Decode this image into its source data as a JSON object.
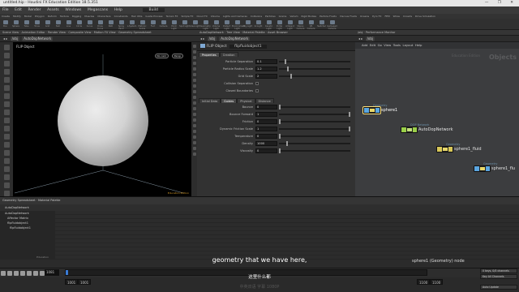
{
  "window": {
    "title": "untitled.hip - Houdini FX Education Edition 18.5.351"
  },
  "menu": [
    "File",
    "Edit",
    "Render",
    "Assets",
    "Windows",
    "Megascans",
    "Help"
  ],
  "desktop": {
    "name": "Build"
  },
  "shelf_tabs": [
    "Create",
    "Modify",
    "Model",
    "Polygon",
    "Deform",
    "Texture",
    "Rigging",
    "Muscles",
    "Characters",
    "Constraints",
    "Hair Utils",
    "Guide Process",
    "Terrain FX",
    "Simple FX",
    "Cloud FX",
    "Volume",
    "Lights and Cameras",
    "Collisions",
    "Particles",
    "Grains",
    "Vellum",
    "Rigid Bodies",
    "Particle Fluids",
    "Viscous Fluids",
    "Oceans",
    "Pyro FX",
    "FEM",
    "Wires",
    "Crowds",
    "Drive Simulation"
  ],
  "shelf_tools": [
    "Box",
    "Sphere",
    "Tube",
    "Torus",
    "Grid",
    "Null",
    "Line",
    "Circle",
    "Curve",
    "Draw Curve",
    "Path",
    "Spray Paint",
    "L-System",
    "Platonic Solids",
    "Font",
    "Camera",
    "Point Light",
    "Spot Light",
    "Area Light",
    "Geometry Light",
    "Volume Light",
    "Distant Light",
    "Environment Light",
    "Sky Light",
    "GI Light",
    "Caustic Light",
    "Portal Light",
    "Ambient Light",
    "Stereo Camera",
    "VR Camera",
    "Switcher",
    "Gamepad Camera"
  ],
  "viewport": {
    "tabs": [
      "Scene View",
      "Animation Editor",
      "Render View",
      "Composite View",
      "Motion FX View",
      "Geometry Spreadsheet"
    ],
    "path": "/obj",
    "node": "AutoDopNetwork",
    "title": "FLIP Object",
    "view_label": "Persp",
    "camera_label": "No cam",
    "watermark": "Education Edition"
  },
  "params": {
    "tabs": [
      "AutoDopNetwork",
      "Tree View",
      "Material Palette",
      "Asset Browser"
    ],
    "path": "/obj",
    "node": "AutoDopNetwork",
    "type": "FLIP Object",
    "name": "flipfluidobject1",
    "subtabs_top": [
      "Properties",
      "Creation"
    ],
    "rows_top": [
      {
        "label": "Particle Separation",
        "value": "0.1",
        "frac": 0.08
      },
      {
        "label": "Particle Radius Scale",
        "value": "1.2",
        "frac": 0.12
      },
      {
        "label": "Grid Scale",
        "value": "2",
        "frac": 0.16
      },
      {
        "label": "Collision Separation",
        "value": "",
        "frac": -1
      },
      {
        "label": "Closed Boundaries",
        "value": "",
        "frac": -1
      }
    ],
    "subtabs_bottom": [
      "Initial Data",
      "Guides",
      "Physical",
      "Distance"
    ],
    "rows_bottom": [
      {
        "label": "Bounce",
        "value": "0",
        "frac": 0
      },
      {
        "label": "Bounce Forward",
        "value": "1",
        "frac": 1
      },
      {
        "label": "Friction",
        "value": "0",
        "frac": 0
      },
      {
        "label": "Dynamic Friction Scale",
        "value": "1",
        "frac": 1
      },
      {
        "label": "Temperature",
        "value": "0",
        "frac": 0
      },
      {
        "label": "Density",
        "value": "1000",
        "frac": 0.1
      },
      {
        "label": "Viscosity",
        "value": "0",
        "frac": 0
      }
    ]
  },
  "graph": {
    "tabs": [
      "/obj",
      "Performance Monitor"
    ],
    "path": "/obj",
    "menu": [
      "Add",
      "Edit",
      "Go",
      "View",
      "Tools",
      "Layout",
      "Help"
    ],
    "watermark": "Education Edition",
    "context_label": "Objects",
    "nodes": [
      {
        "id": "sphere1",
        "label": "sphere1",
        "context": "Geometry",
        "color": "#5ba6e0",
        "selected": true
      },
      {
        "id": "autodop",
        "label": "AutoDopNetwork",
        "context": "DOP Network",
        "color": "#9bd04a",
        "selected": false
      },
      {
        "id": "sphere1_fluid",
        "label": "sphere1_fluid",
        "context": "Geometry",
        "color": "#d9c85a",
        "selected": false
      },
      {
        "id": "sphere1_flu",
        "label": "sphere1_flu",
        "context": "Geometry",
        "color": "#5ba6e0",
        "selected": false
      }
    ]
  },
  "dock": {
    "tabs": [
      "Geometry Spreadsheet",
      "Material Palette"
    ],
    "path": "AutoDopNetwork",
    "tree": [
      "AutoDopNetwork",
      "Affector Matrix",
      "flipfluidobject1",
      "flipfluidobject1"
    ],
    "watermark": "Education"
  },
  "subtitle_en": "geometry that we have here,",
  "subtitle_cn": "这里什么都",
  "watermark_cn": "中英双语 字幕 1080P",
  "status_message": "sphere1 (Geometry) node",
  "playbar": {
    "current_frame": "1081",
    "start": "1001",
    "end": "1001",
    "range_start": "1100",
    "range_end": "1100"
  },
  "right_panel": [
    "0 keys, 0/0 channels",
    "Key All Channels",
    "Auto Update"
  ]
}
